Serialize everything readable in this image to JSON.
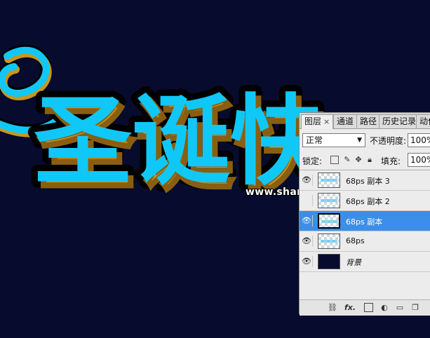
{
  "artwork": {
    "title_text": "圣诞快",
    "watermark": "www.shanjia.net.cn",
    "colors": {
      "background": "#070c2e",
      "fill": "#10c8f8",
      "bevel": "#c8961e",
      "outline": "#000000"
    }
  },
  "layers_panel": {
    "tabs": [
      {
        "label": "图层",
        "close": "×",
        "active": true
      },
      {
        "label": "通道",
        "active": false
      },
      {
        "label": "路径",
        "active": false
      },
      {
        "label": "历史记录",
        "active": false
      },
      {
        "label": "动作",
        "active": false
      }
    ],
    "blend_mode": "正常",
    "opacity_label": "不透明度:",
    "opacity_value": "100%",
    "lock_label": "锁定:",
    "fill_label": "填充:",
    "fill_value": "100%",
    "layers": [
      {
        "name": "68ps 副本 3",
        "visible": true,
        "selected": false
      },
      {
        "name": "68ps 副本 2",
        "visible": false,
        "selected": false
      },
      {
        "name": "68ps 副本",
        "visible": true,
        "selected": true
      },
      {
        "name": "68ps",
        "visible": true,
        "selected": false
      },
      {
        "name": "背景",
        "visible": true,
        "selected": false,
        "is_background": true
      }
    ],
    "bottom_icons": [
      "link-icon",
      "fx-icon",
      "mask-icon",
      "adjustment-icon",
      "folder-icon",
      "new-layer-icon"
    ],
    "fx_label": "fx."
  }
}
